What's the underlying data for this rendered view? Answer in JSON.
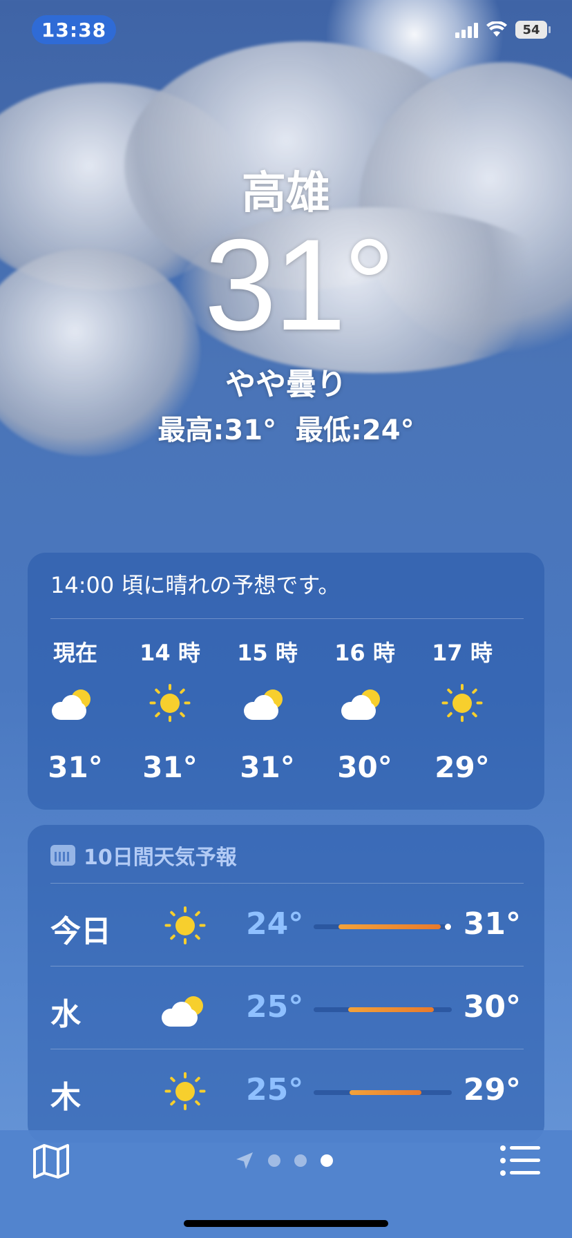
{
  "status": {
    "time": "13:38",
    "battery": "54"
  },
  "location": {
    "city": "高雄",
    "temperature": "31°",
    "condition": "やや曇り",
    "high_low": "最高:31°  最低:24°"
  },
  "hourly": {
    "summary": "14:00 頃に晴れの予想です。",
    "items": [
      {
        "label": "現在",
        "icon": "partly-cloudy-icon",
        "temp": "31°"
      },
      {
        "label": "14 時",
        "icon": "sun-icon",
        "temp": "31°"
      },
      {
        "label": "15 時",
        "icon": "partly-cloudy-icon",
        "temp": "31°"
      },
      {
        "label": "16 時",
        "icon": "partly-cloudy-icon",
        "temp": "30°"
      },
      {
        "label": "17 時",
        "icon": "sun-icon",
        "temp": "29°"
      }
    ]
  },
  "daily": {
    "heading": "10日間天気予報",
    "rows": [
      {
        "day": "今日",
        "icon": "sun-icon",
        "low": "24°",
        "high": "31°",
        "range": [
          0.18,
          0.92
        ],
        "current": 0.97
      },
      {
        "day": "水",
        "icon": "partly-cloudy-icon",
        "low": "25°",
        "high": "30°",
        "range": [
          0.25,
          0.87
        ]
      },
      {
        "day": "木",
        "icon": "sun-icon",
        "low": "25°",
        "high": "29°",
        "range": [
          0.26,
          0.78
        ]
      }
    ]
  },
  "bottom": {
    "pages": 3,
    "active_page": 3
  }
}
